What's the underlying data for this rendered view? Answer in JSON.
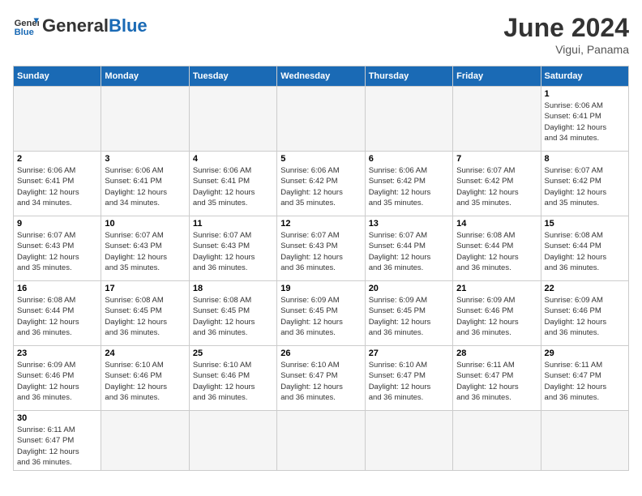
{
  "header": {
    "logo_general": "General",
    "logo_blue": "Blue",
    "month_title": "June 2024",
    "subtitle": "Vigui, Panama"
  },
  "weekdays": [
    "Sunday",
    "Monday",
    "Tuesday",
    "Wednesday",
    "Thursday",
    "Friday",
    "Saturday"
  ],
  "days": {
    "1": {
      "sunrise": "6:06 AM",
      "sunset": "6:41 PM",
      "daylight": "12 hours and 34 minutes."
    },
    "2": {
      "sunrise": "6:06 AM",
      "sunset": "6:41 PM",
      "daylight": "12 hours and 34 minutes."
    },
    "3": {
      "sunrise": "6:06 AM",
      "sunset": "6:41 PM",
      "daylight": "12 hours and 34 minutes."
    },
    "4": {
      "sunrise": "6:06 AM",
      "sunset": "6:41 PM",
      "daylight": "12 hours and 35 minutes."
    },
    "5": {
      "sunrise": "6:06 AM",
      "sunset": "6:42 PM",
      "daylight": "12 hours and 35 minutes."
    },
    "6": {
      "sunrise": "6:06 AM",
      "sunset": "6:42 PM",
      "daylight": "12 hours and 35 minutes."
    },
    "7": {
      "sunrise": "6:07 AM",
      "sunset": "6:42 PM",
      "daylight": "12 hours and 35 minutes."
    },
    "8": {
      "sunrise": "6:07 AM",
      "sunset": "6:42 PM",
      "daylight": "12 hours and 35 minutes."
    },
    "9": {
      "sunrise": "6:07 AM",
      "sunset": "6:43 PM",
      "daylight": "12 hours and 35 minutes."
    },
    "10": {
      "sunrise": "6:07 AM",
      "sunset": "6:43 PM",
      "daylight": "12 hours and 35 minutes."
    },
    "11": {
      "sunrise": "6:07 AM",
      "sunset": "6:43 PM",
      "daylight": "12 hours and 36 minutes."
    },
    "12": {
      "sunrise": "6:07 AM",
      "sunset": "6:43 PM",
      "daylight": "12 hours and 36 minutes."
    },
    "13": {
      "sunrise": "6:07 AM",
      "sunset": "6:44 PM",
      "daylight": "12 hours and 36 minutes."
    },
    "14": {
      "sunrise": "6:08 AM",
      "sunset": "6:44 PM",
      "daylight": "12 hours and 36 minutes."
    },
    "15": {
      "sunrise": "6:08 AM",
      "sunset": "6:44 PM",
      "daylight": "12 hours and 36 minutes."
    },
    "16": {
      "sunrise": "6:08 AM",
      "sunset": "6:44 PM",
      "daylight": "12 hours and 36 minutes."
    },
    "17": {
      "sunrise": "6:08 AM",
      "sunset": "6:45 PM",
      "daylight": "12 hours and 36 minutes."
    },
    "18": {
      "sunrise": "6:08 AM",
      "sunset": "6:45 PM",
      "daylight": "12 hours and 36 minutes."
    },
    "19": {
      "sunrise": "6:09 AM",
      "sunset": "6:45 PM",
      "daylight": "12 hours and 36 minutes."
    },
    "20": {
      "sunrise": "6:09 AM",
      "sunset": "6:45 PM",
      "daylight": "12 hours and 36 minutes."
    },
    "21": {
      "sunrise": "6:09 AM",
      "sunset": "6:46 PM",
      "daylight": "12 hours and 36 minutes."
    },
    "22": {
      "sunrise": "6:09 AM",
      "sunset": "6:46 PM",
      "daylight": "12 hours and 36 minutes."
    },
    "23": {
      "sunrise": "6:09 AM",
      "sunset": "6:46 PM",
      "daylight": "12 hours and 36 minutes."
    },
    "24": {
      "sunrise": "6:10 AM",
      "sunset": "6:46 PM",
      "daylight": "12 hours and 36 minutes."
    },
    "25": {
      "sunrise": "6:10 AM",
      "sunset": "6:46 PM",
      "daylight": "12 hours and 36 minutes."
    },
    "26": {
      "sunrise": "6:10 AM",
      "sunset": "6:47 PM",
      "daylight": "12 hours and 36 minutes."
    },
    "27": {
      "sunrise": "6:10 AM",
      "sunset": "6:47 PM",
      "daylight": "12 hours and 36 minutes."
    },
    "28": {
      "sunrise": "6:11 AM",
      "sunset": "6:47 PM",
      "daylight": "12 hours and 36 minutes."
    },
    "29": {
      "sunrise": "6:11 AM",
      "sunset": "6:47 PM",
      "daylight": "12 hours and 36 minutes."
    },
    "30": {
      "sunrise": "6:11 AM",
      "sunset": "6:47 PM",
      "daylight": "12 hours and 36 minutes."
    }
  }
}
